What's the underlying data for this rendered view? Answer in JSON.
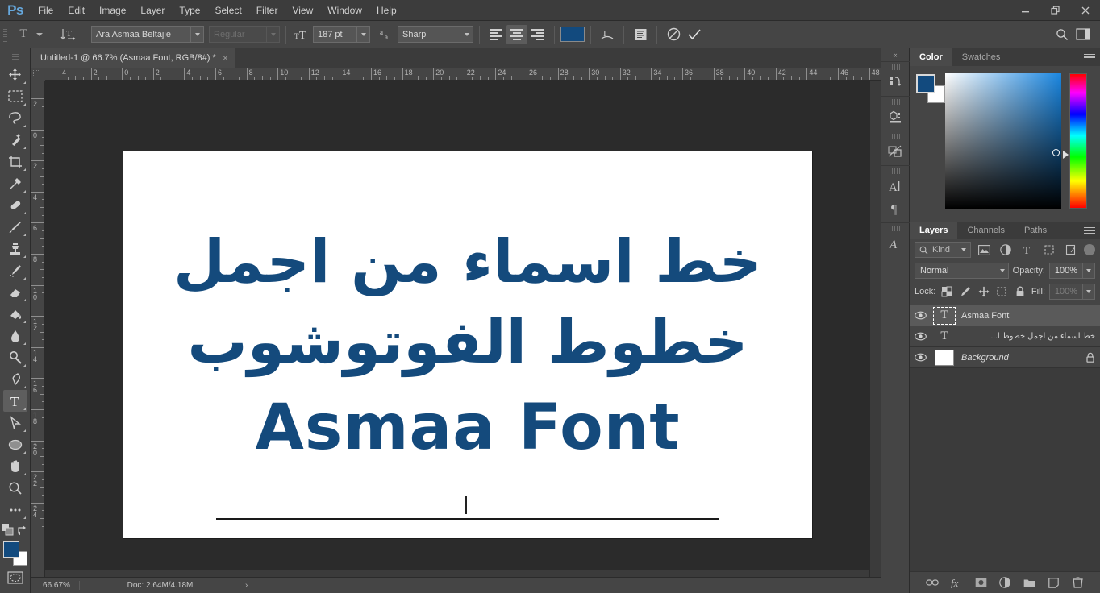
{
  "app": {
    "logo": "Ps"
  },
  "menubar": {
    "items": [
      "File",
      "Edit",
      "Image",
      "Layer",
      "Type",
      "Select",
      "Filter",
      "View",
      "Window",
      "Help"
    ],
    "window_buttons": [
      "minimize",
      "restore",
      "close"
    ]
  },
  "options_bar": {
    "tool_icon": "type-tool",
    "orientation_icon": "text-orientation",
    "font_family": "Ara Asmaa Beltajie",
    "font_style": "Regular",
    "font_style_disabled": true,
    "size_icon": "font-size",
    "font_size": "187 pt",
    "antialias_icon": "anti-alias",
    "antialias": "Sharp",
    "align": [
      "align-left",
      "align-center",
      "align-right"
    ],
    "align_active": 1,
    "text_color": "#124a7e",
    "warp_icon": "warp-text",
    "panels_icon": "toggle-character-panel",
    "cancel_icon": "cancel-edit",
    "commit_icon": "commit-edit"
  },
  "document_tab": {
    "title": "Untitled-1 @ 66.7% (Asmaa Font, RGB/8#) *",
    "close": "×"
  },
  "toolbar": {
    "tools": [
      {
        "name": "move-tool",
        "glyph": "move",
        "has_more": true,
        "selected": false
      },
      {
        "name": "rectangular-marquee-tool",
        "glyph": "marquee",
        "has_more": true,
        "selected": false
      },
      {
        "name": "lasso-tool",
        "glyph": "lasso",
        "has_more": true,
        "selected": false
      },
      {
        "name": "quick-selection-tool",
        "glyph": "magicwand",
        "has_more": true,
        "selected": false
      },
      {
        "name": "crop-tool",
        "glyph": "crop",
        "has_more": true,
        "selected": false
      },
      {
        "name": "eyedropper-tool",
        "glyph": "eyedropper",
        "has_more": true,
        "selected": false
      },
      {
        "name": "healing-brush-tool",
        "glyph": "healing",
        "has_more": true,
        "selected": false
      },
      {
        "name": "brush-tool",
        "glyph": "brush",
        "has_more": true,
        "selected": false
      },
      {
        "name": "clone-stamp-tool",
        "glyph": "stamp",
        "has_more": true,
        "selected": false
      },
      {
        "name": "history-brush-tool",
        "glyph": "historybrush",
        "has_more": true,
        "selected": false
      },
      {
        "name": "eraser-tool",
        "glyph": "eraser",
        "has_more": true,
        "selected": false
      },
      {
        "name": "gradient-tool",
        "glyph": "paintbucket",
        "has_more": true,
        "selected": false
      },
      {
        "name": "blur-tool",
        "glyph": "blur",
        "has_more": true,
        "selected": false
      },
      {
        "name": "dodge-tool",
        "glyph": "dodge",
        "has_more": true,
        "selected": false
      },
      {
        "name": "pen-tool",
        "glyph": "pen",
        "has_more": true,
        "selected": false
      },
      {
        "name": "type-tool",
        "glyph": "type",
        "has_more": true,
        "selected": true
      },
      {
        "name": "path-selection-tool",
        "glyph": "pathselect",
        "has_more": true,
        "selected": false
      },
      {
        "name": "ellipse-tool",
        "glyph": "ellipse",
        "has_more": true,
        "selected": false
      },
      {
        "name": "hand-tool",
        "glyph": "hand",
        "has_more": true,
        "selected": false
      },
      {
        "name": "zoom-tool",
        "glyph": "zoom",
        "has_more": false,
        "selected": false
      },
      {
        "name": "edit-toolbar-tool",
        "glyph": "ellipsis",
        "has_more": true,
        "selected": false
      }
    ],
    "default_colors_icon": "default-foreground-background",
    "swap_colors_icon": "swap-foreground-background",
    "foreground_color": "#124a7e",
    "background_color": "#ffffff",
    "quickmask_icon": "quick-mask-mode"
  },
  "rulers": {
    "unit": "cm",
    "horizontal_labels": [
      "4",
      "2",
      "0",
      "2",
      "4",
      "6",
      "8",
      "10",
      "12",
      "14",
      "16",
      "18",
      "20",
      "22",
      "24",
      "26",
      "28",
      "30",
      "32",
      "34",
      "36",
      "38",
      "40",
      "42",
      "44",
      "46",
      "48"
    ],
    "vertical_labels": [
      "2",
      "0",
      "2",
      "4",
      "6",
      "8",
      "10",
      "12",
      "14",
      "16",
      "18",
      "20",
      "22",
      "24"
    ]
  },
  "canvas": {
    "artwork": {
      "line1_arabic": "خط اسماء من اجمل",
      "line2_arabic": "خطوط الفوتوشوب",
      "line3_latin": "Asmaa Font",
      "text_color": "#144a7c",
      "background": "#ffffff"
    }
  },
  "status_bar": {
    "zoom": "66.67%",
    "doc_info": "Doc: 2.64M/4.18M",
    "expand_arrow": "›"
  },
  "icon_dock": {
    "collapse": "«",
    "groups": [
      {
        "icons": [
          {
            "name": "history-panel-icon",
            "glyph": "history"
          }
        ]
      },
      {
        "icons": [
          {
            "name": "3d-panel-icon",
            "glyph": "cube"
          }
        ]
      },
      {
        "icons": [
          {
            "name": "adjustments-panel-icon",
            "glyph": "adjustments"
          }
        ]
      },
      {
        "icons": [
          {
            "name": "character-panel-icon",
            "glyph": "character"
          },
          {
            "name": "paragraph-panel-icon",
            "glyph": "paragraph"
          }
        ]
      },
      {
        "icons": [
          {
            "name": "styles-panel-icon",
            "glyph": "styles"
          }
        ]
      }
    ]
  },
  "color_panel": {
    "tabs": [
      {
        "label": "Color",
        "active": true
      },
      {
        "label": "Swatches",
        "active": false
      }
    ],
    "foreground": "#124a7e",
    "background": "#ffffff",
    "menu_icon": "panel-menu"
  },
  "layers_panel": {
    "tabs": [
      {
        "label": "Layers",
        "active": true
      },
      {
        "label": "Channels",
        "active": false
      },
      {
        "label": "Paths",
        "active": false
      }
    ],
    "menu_icon": "panel-menu",
    "filter": {
      "placeholder": "Kind",
      "search_icon": "search-icon",
      "type_filters": [
        "filter-pixel",
        "filter-adjustment",
        "filter-type",
        "filter-shape",
        "filter-smart-object"
      ],
      "toggle": "filter-enable-toggle"
    },
    "blend_mode": "Normal",
    "opacity_label": "Opacity:",
    "opacity_value": "100%",
    "lock_label": "Lock:",
    "lock_icons": [
      "lock-transparent-pixels",
      "lock-image-pixels",
      "lock-position",
      "lock-artboard-nesting",
      "lock-all"
    ],
    "fill_label": "Fill:",
    "fill_value": "100%",
    "layers": [
      {
        "name": "Asmaa Font",
        "kind": "type",
        "selected": true,
        "visible": true,
        "locked": false,
        "rtl": false,
        "italic": false
      },
      {
        "name": "خط اسماء من اجمل خطوط ا...",
        "kind": "type",
        "selected": false,
        "visible": true,
        "locked": false,
        "rtl": true,
        "italic": false
      },
      {
        "name": "Background",
        "kind": "raster",
        "selected": false,
        "visible": true,
        "locked": true,
        "rtl": false,
        "italic": true
      }
    ],
    "bottom_buttons": [
      {
        "name": "link-layers-button",
        "glyph": "link"
      },
      {
        "name": "layer-style-button",
        "glyph": "fx"
      },
      {
        "name": "add-layer-mask-button",
        "glyph": "mask"
      },
      {
        "name": "new-adjustment-layer-button",
        "glyph": "adjustment"
      },
      {
        "name": "new-group-button",
        "glyph": "folder"
      },
      {
        "name": "new-layer-button",
        "glyph": "newlayer"
      },
      {
        "name": "delete-layer-button",
        "glyph": "trash"
      }
    ]
  }
}
